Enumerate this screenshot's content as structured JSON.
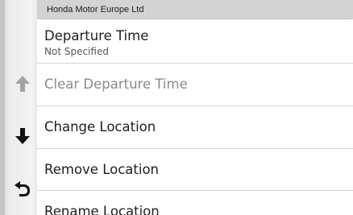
{
  "banner": {
    "text": "Honda Motor Europe Ltd"
  },
  "side_nav": {
    "up_icon": "arrow-up-icon",
    "down_icon": "arrow-down-icon",
    "back_icon": "back-arrow-icon",
    "up_enabled": false,
    "down_enabled": true
  },
  "menu": {
    "items": [
      {
        "label": "Departure Time",
        "sub": "Not Specified",
        "enabled": true
      },
      {
        "label": "Clear Departure Time",
        "enabled": false
      },
      {
        "label": "Change Location",
        "enabled": true
      },
      {
        "label": "Remove Location",
        "enabled": true
      },
      {
        "label": "Rename Location",
        "enabled": true
      }
    ]
  },
  "colors": {
    "side_background": "#ececec",
    "banner_background": "#d3d3d3",
    "divider": "#d6d6d6",
    "text": "#1e1e1e",
    "disabled_text": "#8a8a8a",
    "icon_disabled": "#9a9a9a",
    "icon_enabled": "#111111"
  }
}
